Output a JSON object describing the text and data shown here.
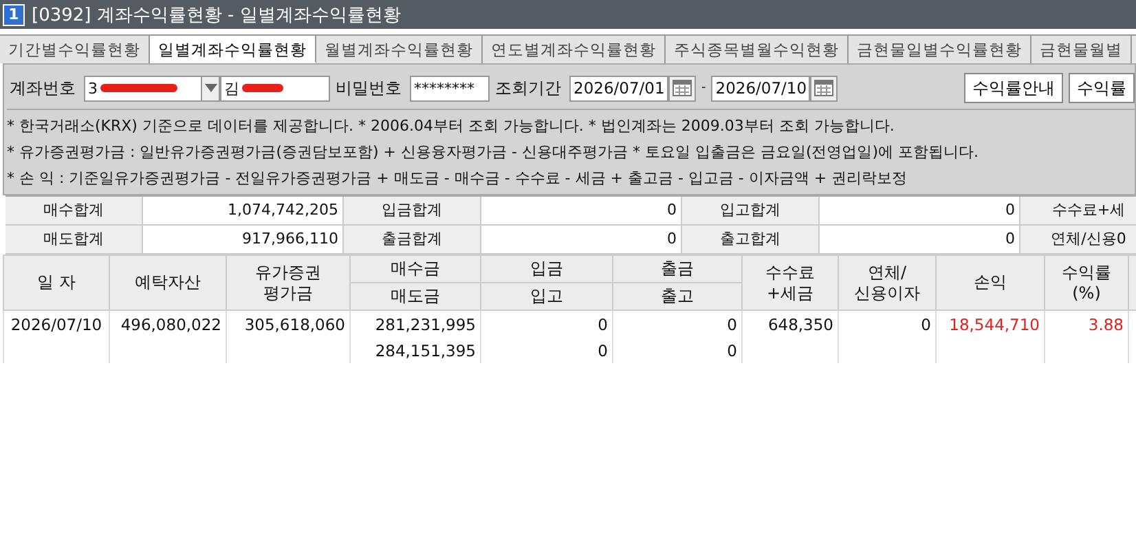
{
  "window": {
    "badge": "1",
    "title": "[0392] 계좌수익률현황 - 일별계좌수익률현황"
  },
  "tabs": [
    {
      "label": "기간별수익률현황",
      "selected": false
    },
    {
      "label": "일별계좌수익률현황",
      "selected": true
    },
    {
      "label": "월별계좌수익률현황",
      "selected": false
    },
    {
      "label": "연도별계좌수익률현황",
      "selected": false
    },
    {
      "label": "주식종목별월수익현황",
      "selected": false
    },
    {
      "label": "금현물일별수익률현황",
      "selected": false
    },
    {
      "label": "금현물월별",
      "selected": false
    }
  ],
  "query": {
    "account_label": "계좌번호",
    "account_number": "3",
    "account_redacted": true,
    "name": "김",
    "name_redacted": true,
    "password_label": "비밀번호",
    "password": "********",
    "period_label": "조회기간",
    "start_date": "2026/07/01",
    "separator": "-",
    "end_date": "2026/07/10"
  },
  "buttons": [
    "수익률안내",
    "수익률"
  ],
  "notices": [
    "* 한국거래소(KRX) 기준으로 데이터를 제공합니다.  * 2006.04부터 조회 가능합니다.  * 법인계좌는 2009.03부터 조회 가능합니다.",
    "* 유가증권평가금 : 일반유가증권평가금(증권담보포함) + 신용융자평가금 - 신용대주평가금  * 토요일 입출금은 금요일(전영업일)에 포함됩니다.",
    "* 손          익 : 기준일유가증권평가금 - 전일유가증권평가금 + 매도금 - 매수금 - 수수료 - 세금 + 출고금 - 입고금 - 이자금액 + 권리락보정"
  ],
  "summary": [
    [
      {
        "label": "매수합계",
        "value": "1,074,742,205"
      },
      {
        "label": "입금합계",
        "value": "0"
      },
      {
        "label": "입고합계",
        "value": "0"
      },
      {
        "label": "수수료+세"
      }
    ],
    [
      {
        "label": "매도합계",
        "value": "917,966,110"
      },
      {
        "label": "출금합계",
        "value": "0"
      },
      {
        "label": "출고합계",
        "value": "0"
      },
      {
        "label": "연체/신용0"
      }
    ]
  ],
  "table": {
    "columns": [
      {
        "label": "일 자",
        "kind": "date"
      },
      {
        "label": "예탁자산",
        "kind": "amount"
      },
      {
        "label": "유가증권\n평가금",
        "kind": "amount"
      },
      {
        "label": "매수금",
        "sublabel": "매도금",
        "kind": "amount"
      },
      {
        "label": "입금",
        "sublabel": "입고",
        "kind": "amount"
      },
      {
        "label": "출금",
        "sublabel": "출고",
        "kind": "amount"
      },
      {
        "label": "수수료\n+세금",
        "kind": "amount"
      },
      {
        "label": "연체/\n신용이자",
        "kind": "amount"
      },
      {
        "label": "손익",
        "kind": "profit"
      },
      {
        "label": "수익률\n(%)",
        "kind": "profit"
      }
    ],
    "rows": [
      {
        "positive": true,
        "values": [
          [
            "2026/07/10"
          ],
          [
            "496,080,022"
          ],
          [
            "305,618,060"
          ],
          [
            "281,231,995",
            "284,151,395"
          ],
          [
            "0",
            "0"
          ],
          [
            "0",
            "0"
          ],
          [
            "648,350"
          ],
          [
            "0"
          ],
          [
            "18,544,710"
          ],
          [
            "3.88"
          ]
        ]
      }
    ]
  }
}
